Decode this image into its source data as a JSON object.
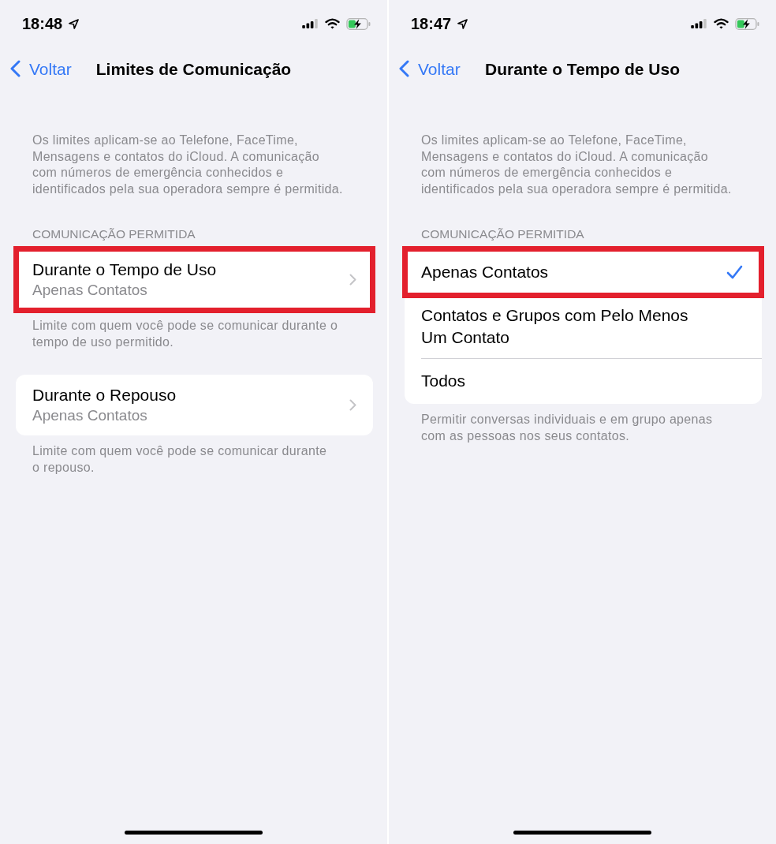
{
  "screens": [
    {
      "status_bar": {
        "time": "18:48"
      },
      "nav": {
        "back": "Voltar",
        "title": "Limites de Comunicação"
      },
      "intro": "Os limites aplicam-se ao Telefone, FaceTime,\nMensagens e contatos do iCloud. A comunicação\ncom números de emergência conhecidos e\nidentificados pela sua operadora sempre é permitida.",
      "groups": [
        {
          "header": "COMUNICAÇÃO PERMITIDA",
          "items": [
            {
              "kind": "link",
              "title": "Durante o Tempo de Uso",
              "value": "Apenas Contatos",
              "highlighted": true
            }
          ],
          "footer": "Limite com quem você pode se comunicar durante o\ntempo de uso permitido."
        },
        {
          "items": [
            {
              "kind": "link",
              "title": "Durante o Repouso",
              "value": "Apenas Contatos",
              "highlighted": false
            }
          ],
          "footer": "Limite com quem você pode se comunicar durante\no repouso."
        }
      ]
    },
    {
      "status_bar": {
        "time": "18:47"
      },
      "nav": {
        "back": "Voltar",
        "title": "Durante o Tempo de Uso"
      },
      "intro": "Os limites aplicam-se ao Telefone, FaceTime,\nMensagens e contatos do iCloud. A comunicação\ncom números de emergência conhecidos e\nidentificados pela sua operadora sempre é permitida.",
      "groups": [
        {
          "header": "COMUNICAÇÃO PERMITIDA",
          "items": [
            {
              "kind": "option",
              "label": "Apenas Contatos",
              "selected": true,
              "highlighted": true
            },
            {
              "kind": "option",
              "label": "Contatos e Grupos com Pelo Menos\nUm Contato",
              "selected": false,
              "highlighted": false
            },
            {
              "kind": "option",
              "label": "Todos",
              "selected": false,
              "highlighted": false
            }
          ],
          "footer": "Permitir conversas individuais e em grupo apenas\ncom as pessoas nos seus contatos."
        }
      ]
    }
  ]
}
